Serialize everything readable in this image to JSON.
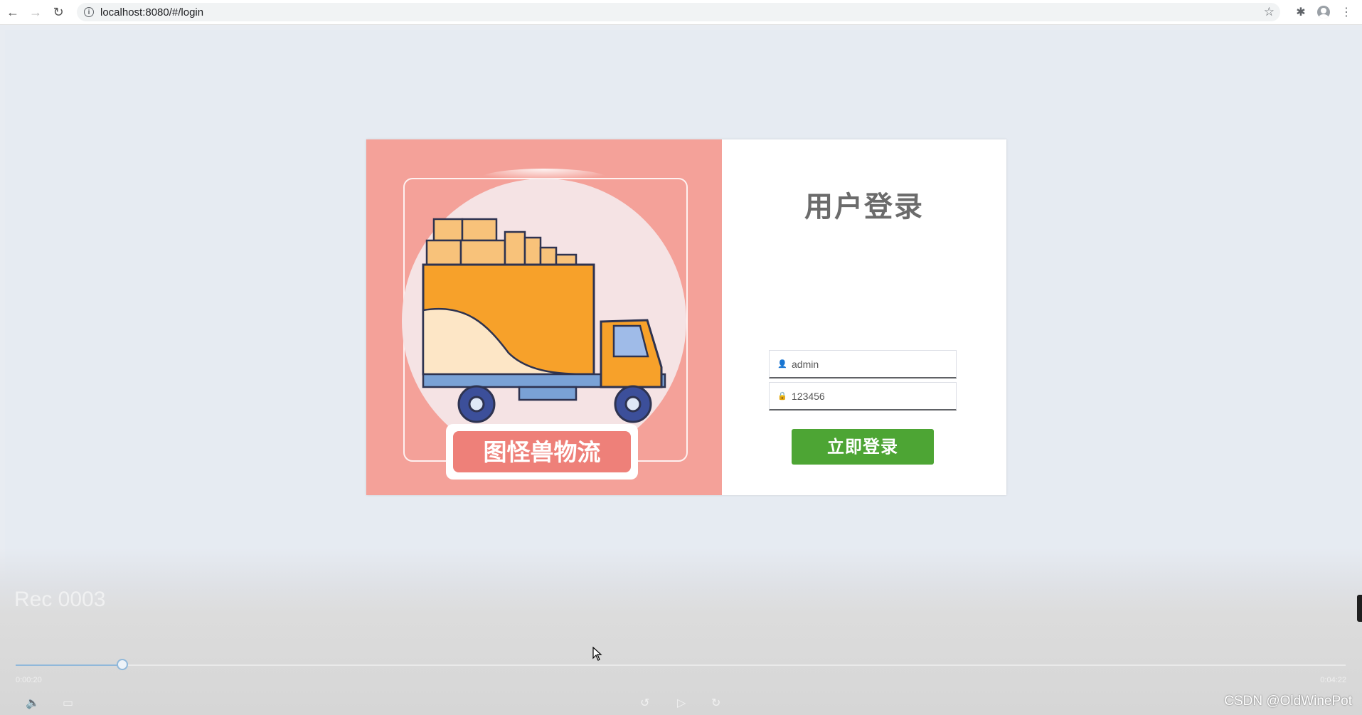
{
  "browser": {
    "url": "localhost:8080/#/login",
    "back_icon": "←",
    "forward_icon": "→",
    "reload_icon": "↻",
    "info_icon": "i",
    "star_icon": "☆",
    "extensions_icon": "✱",
    "menu_icon": "⋮"
  },
  "login": {
    "title": "用户登录",
    "username_value": "admin",
    "password_value": "123456",
    "username_icon": "👤",
    "password_icon": "🔒",
    "submit_label": "立即登录"
  },
  "illustration": {
    "banner_text": "图怪兽物流",
    "background_color": "#f4a199",
    "truck_color": "#f7a12a"
  },
  "player": {
    "title": "Rec 0003",
    "current_time": "0:00:20",
    "duration": "0:04:22",
    "progress": 0.08,
    "volume_icon": "🔈",
    "captions_icon": "▭",
    "rewind_icon": "↺",
    "play_icon": "▷",
    "forward_icon": "↻"
  },
  "watermark": "CSDN @OldWinePot"
}
